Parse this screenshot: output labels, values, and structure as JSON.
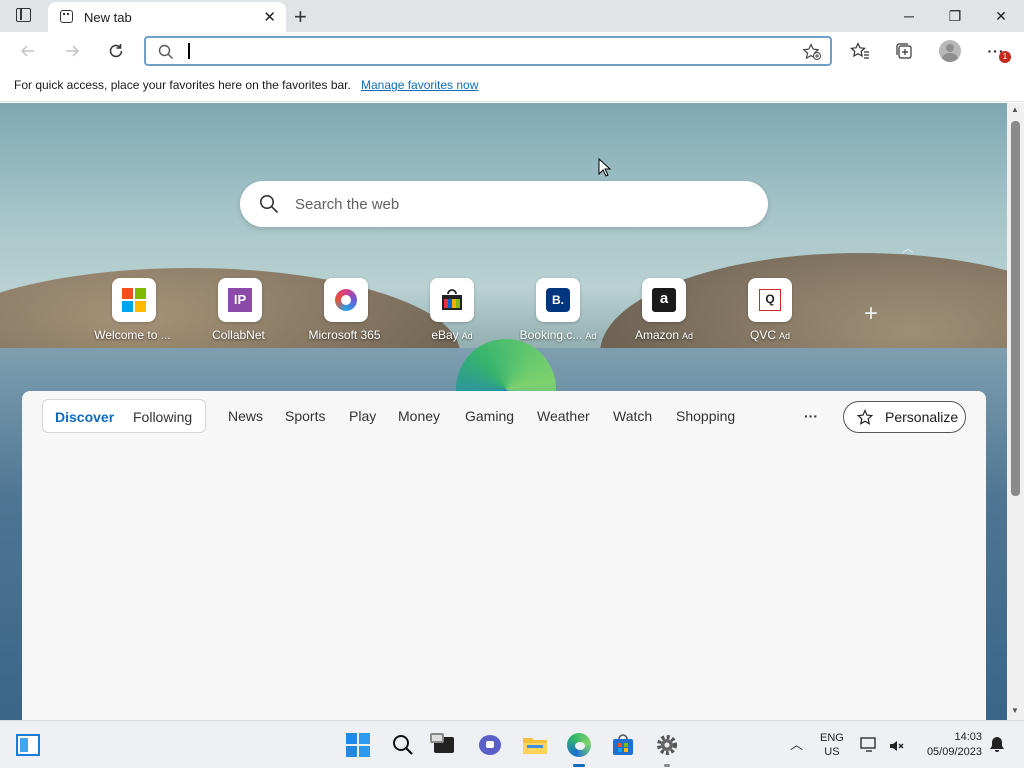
{
  "tab": {
    "title": "New tab"
  },
  "window": {
    "minimize": "─",
    "restore": "❐",
    "close": "✕"
  },
  "favorites_bar": {
    "message": "For quick access, place your favorites here on the favorites bar.",
    "manage_link": "Manage favorites now"
  },
  "address_bar": {
    "value": "",
    "notification_badge": "1"
  },
  "search": {
    "placeholder": "Search the web"
  },
  "quick_links": [
    {
      "label": "Welcome to ...",
      "ad": ""
    },
    {
      "label": "CollabNet",
      "ad": ""
    },
    {
      "label": "Microsoft 365",
      "ad": ""
    },
    {
      "label": "eBay",
      "ad": "Ad"
    },
    {
      "label": "Booking.c...",
      "ad": "Ad"
    },
    {
      "label": "Amazon",
      "ad": "Ad"
    },
    {
      "label": "QVC",
      "ad": "Ad"
    }
  ],
  "feed": {
    "pill_tabs": [
      "Discover",
      "Following"
    ],
    "tabs": [
      "News",
      "Sports",
      "Play",
      "Money",
      "Gaming",
      "Weather",
      "Watch",
      "Shopping"
    ],
    "more": "···",
    "personalize": "Personalize"
  },
  "taskbar": {
    "lang_line1": "ENG",
    "lang_line2": "US",
    "time": "14:03",
    "date": "05/09/2023"
  },
  "colors": {
    "accent": "#0f6cbd",
    "active_tab": "#0f6cbd"
  }
}
